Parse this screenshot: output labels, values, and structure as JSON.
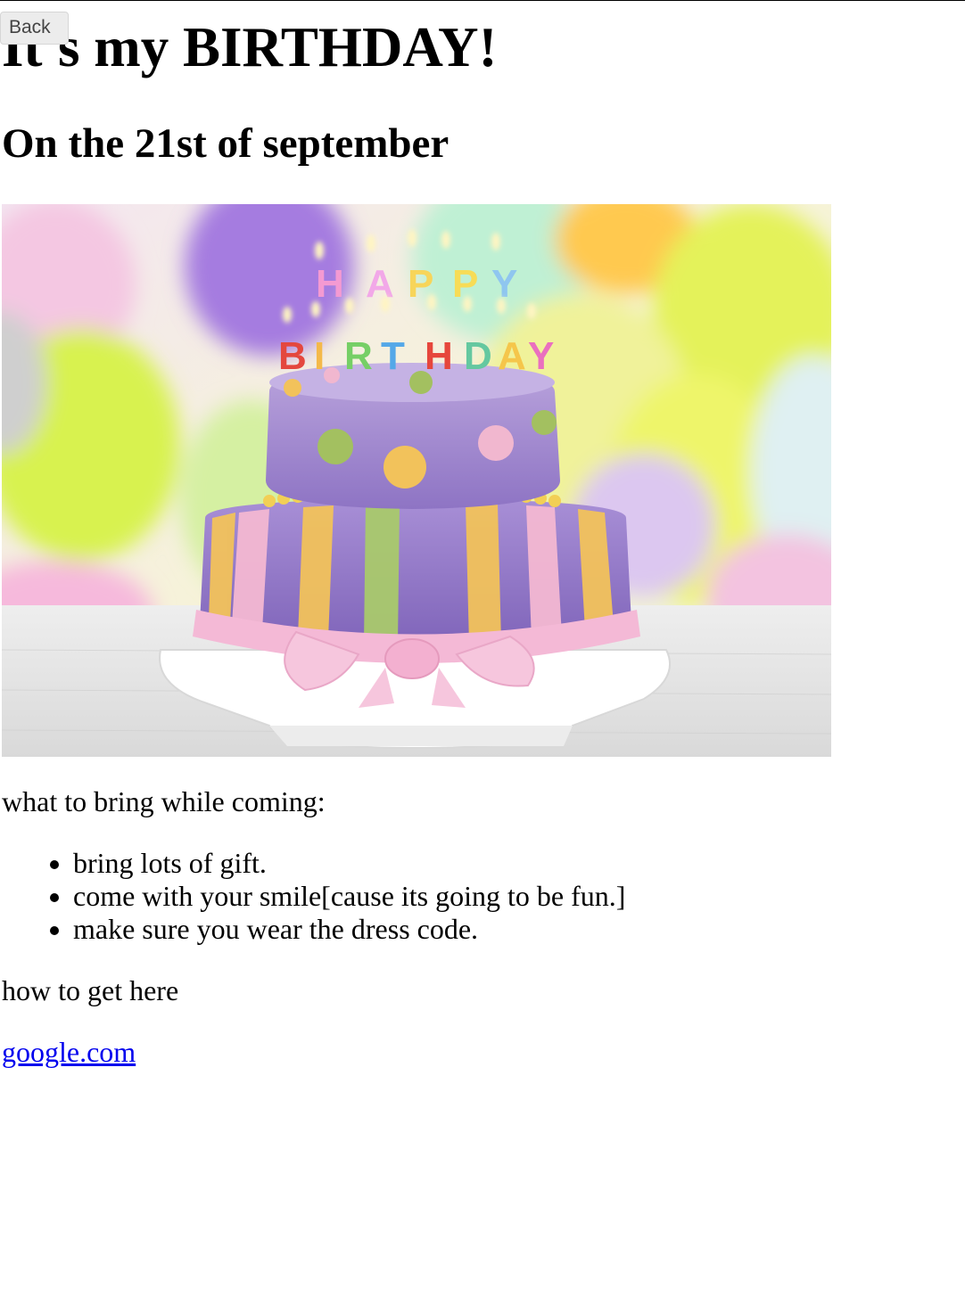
{
  "navigation": {
    "back_label": "Back"
  },
  "header": {
    "title": "It's my BIRTHDAY!",
    "subtitle": "On the 21st of september"
  },
  "image": {
    "description_icon": "birthday-cake-photo",
    "candle_text_top": "HAPPY",
    "candle_text_bottom": "BIRTHDAY"
  },
  "content": {
    "bring_intro": "what to bring while coming:",
    "bring_items": [
      "bring lots of gift.",
      "come with your smile[cause its going to be fun.]",
      "make sure you wear the dress code."
    ],
    "directions_label": "how to get here",
    "link_text": "google.com"
  },
  "colors": {
    "link": "#0000ee",
    "text": "#000000",
    "background": "#ffffff"
  }
}
